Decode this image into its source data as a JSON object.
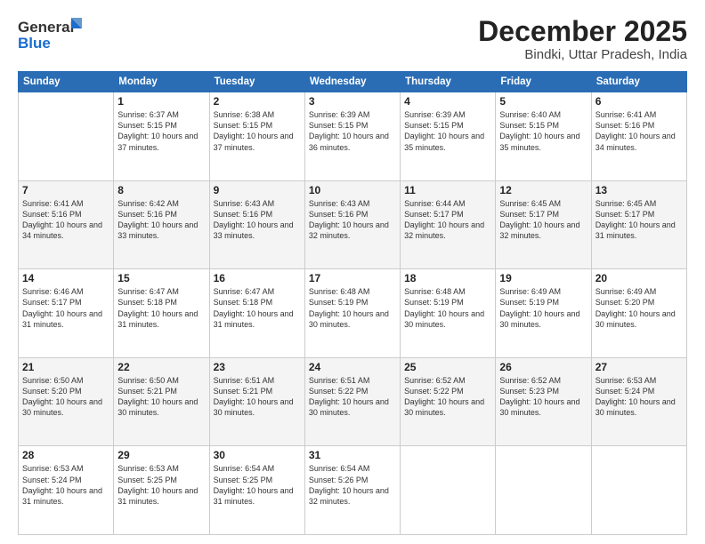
{
  "header": {
    "logo_line1": "General",
    "logo_line2": "Blue",
    "month": "December 2025",
    "location": "Bindki, Uttar Pradesh, India"
  },
  "days_of_week": [
    "Sunday",
    "Monday",
    "Tuesday",
    "Wednesday",
    "Thursday",
    "Friday",
    "Saturday"
  ],
  "weeks": [
    [
      {
        "day": "",
        "sunrise": "",
        "sunset": "",
        "daylight": ""
      },
      {
        "day": "1",
        "sunrise": "Sunrise: 6:37 AM",
        "sunset": "Sunset: 5:15 PM",
        "daylight": "Daylight: 10 hours and 37 minutes."
      },
      {
        "day": "2",
        "sunrise": "Sunrise: 6:38 AM",
        "sunset": "Sunset: 5:15 PM",
        "daylight": "Daylight: 10 hours and 37 minutes."
      },
      {
        "day": "3",
        "sunrise": "Sunrise: 6:39 AM",
        "sunset": "Sunset: 5:15 PM",
        "daylight": "Daylight: 10 hours and 36 minutes."
      },
      {
        "day": "4",
        "sunrise": "Sunrise: 6:39 AM",
        "sunset": "Sunset: 5:15 PM",
        "daylight": "Daylight: 10 hours and 35 minutes."
      },
      {
        "day": "5",
        "sunrise": "Sunrise: 6:40 AM",
        "sunset": "Sunset: 5:15 PM",
        "daylight": "Daylight: 10 hours and 35 minutes."
      },
      {
        "day": "6",
        "sunrise": "Sunrise: 6:41 AM",
        "sunset": "Sunset: 5:16 PM",
        "daylight": "Daylight: 10 hours and 34 minutes."
      }
    ],
    [
      {
        "day": "7",
        "sunrise": "Sunrise: 6:41 AM",
        "sunset": "Sunset: 5:16 PM",
        "daylight": "Daylight: 10 hours and 34 minutes."
      },
      {
        "day": "8",
        "sunrise": "Sunrise: 6:42 AM",
        "sunset": "Sunset: 5:16 PM",
        "daylight": "Daylight: 10 hours and 33 minutes."
      },
      {
        "day": "9",
        "sunrise": "Sunrise: 6:43 AM",
        "sunset": "Sunset: 5:16 PM",
        "daylight": "Daylight: 10 hours and 33 minutes."
      },
      {
        "day": "10",
        "sunrise": "Sunrise: 6:43 AM",
        "sunset": "Sunset: 5:16 PM",
        "daylight": "Daylight: 10 hours and 32 minutes."
      },
      {
        "day": "11",
        "sunrise": "Sunrise: 6:44 AM",
        "sunset": "Sunset: 5:17 PM",
        "daylight": "Daylight: 10 hours and 32 minutes."
      },
      {
        "day": "12",
        "sunrise": "Sunrise: 6:45 AM",
        "sunset": "Sunset: 5:17 PM",
        "daylight": "Daylight: 10 hours and 32 minutes."
      },
      {
        "day": "13",
        "sunrise": "Sunrise: 6:45 AM",
        "sunset": "Sunset: 5:17 PM",
        "daylight": "Daylight: 10 hours and 31 minutes."
      }
    ],
    [
      {
        "day": "14",
        "sunrise": "Sunrise: 6:46 AM",
        "sunset": "Sunset: 5:17 PM",
        "daylight": "Daylight: 10 hours and 31 minutes."
      },
      {
        "day": "15",
        "sunrise": "Sunrise: 6:47 AM",
        "sunset": "Sunset: 5:18 PM",
        "daylight": "Daylight: 10 hours and 31 minutes."
      },
      {
        "day": "16",
        "sunrise": "Sunrise: 6:47 AM",
        "sunset": "Sunset: 5:18 PM",
        "daylight": "Daylight: 10 hours and 31 minutes."
      },
      {
        "day": "17",
        "sunrise": "Sunrise: 6:48 AM",
        "sunset": "Sunset: 5:19 PM",
        "daylight": "Daylight: 10 hours and 30 minutes."
      },
      {
        "day": "18",
        "sunrise": "Sunrise: 6:48 AM",
        "sunset": "Sunset: 5:19 PM",
        "daylight": "Daylight: 10 hours and 30 minutes."
      },
      {
        "day": "19",
        "sunrise": "Sunrise: 6:49 AM",
        "sunset": "Sunset: 5:19 PM",
        "daylight": "Daylight: 10 hours and 30 minutes."
      },
      {
        "day": "20",
        "sunrise": "Sunrise: 6:49 AM",
        "sunset": "Sunset: 5:20 PM",
        "daylight": "Daylight: 10 hours and 30 minutes."
      }
    ],
    [
      {
        "day": "21",
        "sunrise": "Sunrise: 6:50 AM",
        "sunset": "Sunset: 5:20 PM",
        "daylight": "Daylight: 10 hours and 30 minutes."
      },
      {
        "day": "22",
        "sunrise": "Sunrise: 6:50 AM",
        "sunset": "Sunset: 5:21 PM",
        "daylight": "Daylight: 10 hours and 30 minutes."
      },
      {
        "day": "23",
        "sunrise": "Sunrise: 6:51 AM",
        "sunset": "Sunset: 5:21 PM",
        "daylight": "Daylight: 10 hours and 30 minutes."
      },
      {
        "day": "24",
        "sunrise": "Sunrise: 6:51 AM",
        "sunset": "Sunset: 5:22 PM",
        "daylight": "Daylight: 10 hours and 30 minutes."
      },
      {
        "day": "25",
        "sunrise": "Sunrise: 6:52 AM",
        "sunset": "Sunset: 5:22 PM",
        "daylight": "Daylight: 10 hours and 30 minutes."
      },
      {
        "day": "26",
        "sunrise": "Sunrise: 6:52 AM",
        "sunset": "Sunset: 5:23 PM",
        "daylight": "Daylight: 10 hours and 30 minutes."
      },
      {
        "day": "27",
        "sunrise": "Sunrise: 6:53 AM",
        "sunset": "Sunset: 5:24 PM",
        "daylight": "Daylight: 10 hours and 30 minutes."
      }
    ],
    [
      {
        "day": "28",
        "sunrise": "Sunrise: 6:53 AM",
        "sunset": "Sunset: 5:24 PM",
        "daylight": "Daylight: 10 hours and 31 minutes."
      },
      {
        "day": "29",
        "sunrise": "Sunrise: 6:53 AM",
        "sunset": "Sunset: 5:25 PM",
        "daylight": "Daylight: 10 hours and 31 minutes."
      },
      {
        "day": "30",
        "sunrise": "Sunrise: 6:54 AM",
        "sunset": "Sunset: 5:25 PM",
        "daylight": "Daylight: 10 hours and 31 minutes."
      },
      {
        "day": "31",
        "sunrise": "Sunrise: 6:54 AM",
        "sunset": "Sunset: 5:26 PM",
        "daylight": "Daylight: 10 hours and 32 minutes."
      },
      {
        "day": "",
        "sunrise": "",
        "sunset": "",
        "daylight": ""
      },
      {
        "day": "",
        "sunrise": "",
        "sunset": "",
        "daylight": ""
      },
      {
        "day": "",
        "sunrise": "",
        "sunset": "",
        "daylight": ""
      }
    ]
  ]
}
